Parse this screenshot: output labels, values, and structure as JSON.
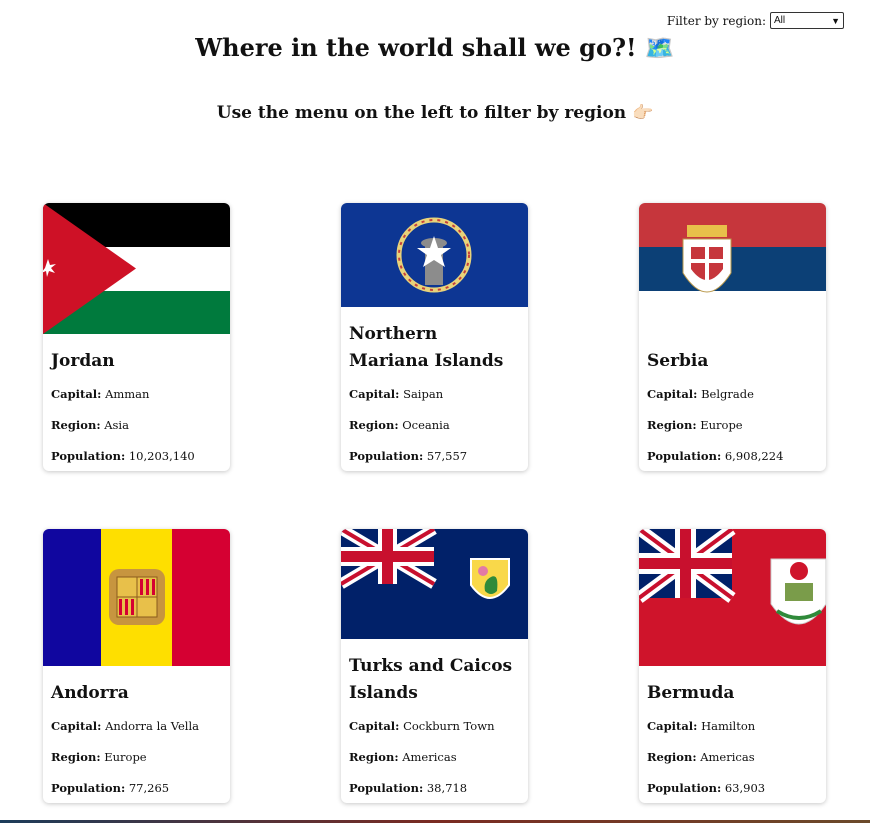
{
  "filter": {
    "label": "Filter by region:",
    "selected": "All"
  },
  "header": {
    "title": "Where in the world shall we go?! 🗺️",
    "subtitle": "Use the menu on the left to filter by region 👉🏻"
  },
  "labels": {
    "capital": "Capital:",
    "region": "Region:",
    "population": "Population:"
  },
  "countries": [
    {
      "name": "Jordan",
      "capital": "Amman",
      "region": "Asia",
      "population": "10,203,140"
    },
    {
      "name": "Northern Mariana Islands",
      "capital": "Saipan",
      "region": "Oceania",
      "population": "57,557"
    },
    {
      "name": "Serbia",
      "capital": "Belgrade",
      "region": "Europe",
      "population": "6,908,224"
    },
    {
      "name": "Andorra",
      "capital": "Andorra la Vella",
      "region": "Europe",
      "population": "77,265"
    },
    {
      "name": "Turks and Caicos Islands",
      "capital": "Cockburn Town",
      "region": "Americas",
      "population": "38,718"
    },
    {
      "name": "Bermuda",
      "capital": "Hamilton",
      "region": "Americas",
      "population": "63,903"
    }
  ]
}
